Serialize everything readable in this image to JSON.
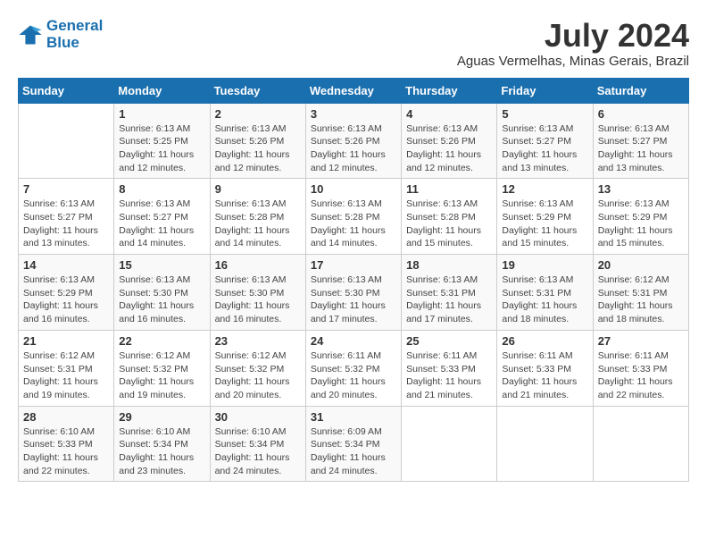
{
  "header": {
    "logo_line1": "General",
    "logo_line2": "Blue",
    "month_title": "July 2024",
    "location": "Aguas Vermelhas, Minas Gerais, Brazil"
  },
  "weekdays": [
    "Sunday",
    "Monday",
    "Tuesday",
    "Wednesday",
    "Thursday",
    "Friday",
    "Saturday"
  ],
  "weeks": [
    [
      {
        "day": "",
        "sunrise": "",
        "sunset": "",
        "daylight": ""
      },
      {
        "day": "1",
        "sunrise": "Sunrise: 6:13 AM",
        "sunset": "Sunset: 5:25 PM",
        "daylight": "Daylight: 11 hours and 12 minutes."
      },
      {
        "day": "2",
        "sunrise": "Sunrise: 6:13 AM",
        "sunset": "Sunset: 5:26 PM",
        "daylight": "Daylight: 11 hours and 12 minutes."
      },
      {
        "day": "3",
        "sunrise": "Sunrise: 6:13 AM",
        "sunset": "Sunset: 5:26 PM",
        "daylight": "Daylight: 11 hours and 12 minutes."
      },
      {
        "day": "4",
        "sunrise": "Sunrise: 6:13 AM",
        "sunset": "Sunset: 5:26 PM",
        "daylight": "Daylight: 11 hours and 12 minutes."
      },
      {
        "day": "5",
        "sunrise": "Sunrise: 6:13 AM",
        "sunset": "Sunset: 5:27 PM",
        "daylight": "Daylight: 11 hours and 13 minutes."
      },
      {
        "day": "6",
        "sunrise": "Sunrise: 6:13 AM",
        "sunset": "Sunset: 5:27 PM",
        "daylight": "Daylight: 11 hours and 13 minutes."
      }
    ],
    [
      {
        "day": "7",
        "sunrise": "Sunrise: 6:13 AM",
        "sunset": "Sunset: 5:27 PM",
        "daylight": "Daylight: 11 hours and 13 minutes."
      },
      {
        "day": "8",
        "sunrise": "Sunrise: 6:13 AM",
        "sunset": "Sunset: 5:27 PM",
        "daylight": "Daylight: 11 hours and 14 minutes."
      },
      {
        "day": "9",
        "sunrise": "Sunrise: 6:13 AM",
        "sunset": "Sunset: 5:28 PM",
        "daylight": "Daylight: 11 hours and 14 minutes."
      },
      {
        "day": "10",
        "sunrise": "Sunrise: 6:13 AM",
        "sunset": "Sunset: 5:28 PM",
        "daylight": "Daylight: 11 hours and 14 minutes."
      },
      {
        "day": "11",
        "sunrise": "Sunrise: 6:13 AM",
        "sunset": "Sunset: 5:28 PM",
        "daylight": "Daylight: 11 hours and 15 minutes."
      },
      {
        "day": "12",
        "sunrise": "Sunrise: 6:13 AM",
        "sunset": "Sunset: 5:29 PM",
        "daylight": "Daylight: 11 hours and 15 minutes."
      },
      {
        "day": "13",
        "sunrise": "Sunrise: 6:13 AM",
        "sunset": "Sunset: 5:29 PM",
        "daylight": "Daylight: 11 hours and 15 minutes."
      }
    ],
    [
      {
        "day": "14",
        "sunrise": "Sunrise: 6:13 AM",
        "sunset": "Sunset: 5:29 PM",
        "daylight": "Daylight: 11 hours and 16 minutes."
      },
      {
        "day": "15",
        "sunrise": "Sunrise: 6:13 AM",
        "sunset": "Sunset: 5:30 PM",
        "daylight": "Daylight: 11 hours and 16 minutes."
      },
      {
        "day": "16",
        "sunrise": "Sunrise: 6:13 AM",
        "sunset": "Sunset: 5:30 PM",
        "daylight": "Daylight: 11 hours and 16 minutes."
      },
      {
        "day": "17",
        "sunrise": "Sunrise: 6:13 AM",
        "sunset": "Sunset: 5:30 PM",
        "daylight": "Daylight: 11 hours and 17 minutes."
      },
      {
        "day": "18",
        "sunrise": "Sunrise: 6:13 AM",
        "sunset": "Sunset: 5:31 PM",
        "daylight": "Daylight: 11 hours and 17 minutes."
      },
      {
        "day": "19",
        "sunrise": "Sunrise: 6:13 AM",
        "sunset": "Sunset: 5:31 PM",
        "daylight": "Daylight: 11 hours and 18 minutes."
      },
      {
        "day": "20",
        "sunrise": "Sunrise: 6:12 AM",
        "sunset": "Sunset: 5:31 PM",
        "daylight": "Daylight: 11 hours and 18 minutes."
      }
    ],
    [
      {
        "day": "21",
        "sunrise": "Sunrise: 6:12 AM",
        "sunset": "Sunset: 5:31 PM",
        "daylight": "Daylight: 11 hours and 19 minutes."
      },
      {
        "day": "22",
        "sunrise": "Sunrise: 6:12 AM",
        "sunset": "Sunset: 5:32 PM",
        "daylight": "Daylight: 11 hours and 19 minutes."
      },
      {
        "day": "23",
        "sunrise": "Sunrise: 6:12 AM",
        "sunset": "Sunset: 5:32 PM",
        "daylight": "Daylight: 11 hours and 20 minutes."
      },
      {
        "day": "24",
        "sunrise": "Sunrise: 6:11 AM",
        "sunset": "Sunset: 5:32 PM",
        "daylight": "Daylight: 11 hours and 20 minutes."
      },
      {
        "day": "25",
        "sunrise": "Sunrise: 6:11 AM",
        "sunset": "Sunset: 5:33 PM",
        "daylight": "Daylight: 11 hours and 21 minutes."
      },
      {
        "day": "26",
        "sunrise": "Sunrise: 6:11 AM",
        "sunset": "Sunset: 5:33 PM",
        "daylight": "Daylight: 11 hours and 21 minutes."
      },
      {
        "day": "27",
        "sunrise": "Sunrise: 6:11 AM",
        "sunset": "Sunset: 5:33 PM",
        "daylight": "Daylight: 11 hours and 22 minutes."
      }
    ],
    [
      {
        "day": "28",
        "sunrise": "Sunrise: 6:10 AM",
        "sunset": "Sunset: 5:33 PM",
        "daylight": "Daylight: 11 hours and 22 minutes."
      },
      {
        "day": "29",
        "sunrise": "Sunrise: 6:10 AM",
        "sunset": "Sunset: 5:34 PM",
        "daylight": "Daylight: 11 hours and 23 minutes."
      },
      {
        "day": "30",
        "sunrise": "Sunrise: 6:10 AM",
        "sunset": "Sunset: 5:34 PM",
        "daylight": "Daylight: 11 hours and 24 minutes."
      },
      {
        "day": "31",
        "sunrise": "Sunrise: 6:09 AM",
        "sunset": "Sunset: 5:34 PM",
        "daylight": "Daylight: 11 hours and 24 minutes."
      },
      {
        "day": "",
        "sunrise": "",
        "sunset": "",
        "daylight": ""
      },
      {
        "day": "",
        "sunrise": "",
        "sunset": "",
        "daylight": ""
      },
      {
        "day": "",
        "sunrise": "",
        "sunset": "",
        "daylight": ""
      }
    ]
  ]
}
